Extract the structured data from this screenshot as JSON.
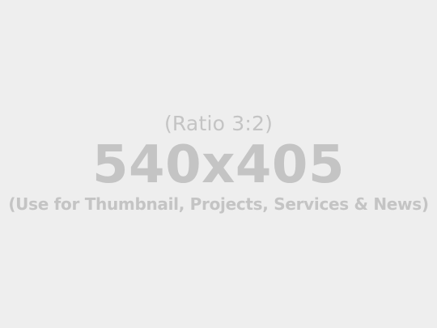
{
  "placeholder": {
    "ratio_text": "(Ratio 3:2)",
    "dimensions_text": "540x405",
    "usage_text": "(Use for Thumbnail, Projects, Services & News)"
  },
  "colors": {
    "background": "#eeeeee",
    "text": "#c4c4c4"
  }
}
